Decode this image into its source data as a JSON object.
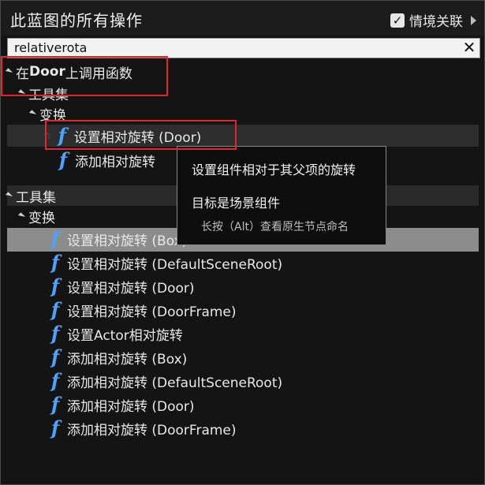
{
  "header": {
    "title": "此蓝图的所有操作",
    "context_label": "情境关联",
    "context_checked": true
  },
  "search": {
    "value": "relativerota",
    "clear_symbol": "✕"
  },
  "tree": {
    "group1_label_prefix": "在 ",
    "group1_label_bold": "Door",
    "group1_label_suffix": "上调用函数",
    "group1_cat": "工具集",
    "group1_sub": "变换",
    "group1_items": [
      "设置相对旋转 (Door)",
      "添加相对旋转"
    ],
    "group2_label": "工具集",
    "group2_sub": "变换",
    "group2_items": [
      "设置相对旋转 (Box)",
      "设置相对旋转 (DefaultSceneRoot)",
      "设置相对旋转 (Door)",
      "设置相对旋转 (DoorFrame)",
      "设置Actor相对旋转",
      "添加相对旋转 (Box)",
      "添加相对旋转 (DefaultSceneRoot)",
      "添加相对旋转 (Door)",
      "添加相对旋转 (DoorFrame)"
    ]
  },
  "tooltip": {
    "description": "设置组件相对于其父项的旋转",
    "target": "目标是场景组件",
    "hint": "长按（Alt）查看原生节点命名"
  },
  "colors": {
    "accent": "#4aa3ff",
    "highlight": "#e3262e",
    "selected_row": "#8c8c8c"
  }
}
